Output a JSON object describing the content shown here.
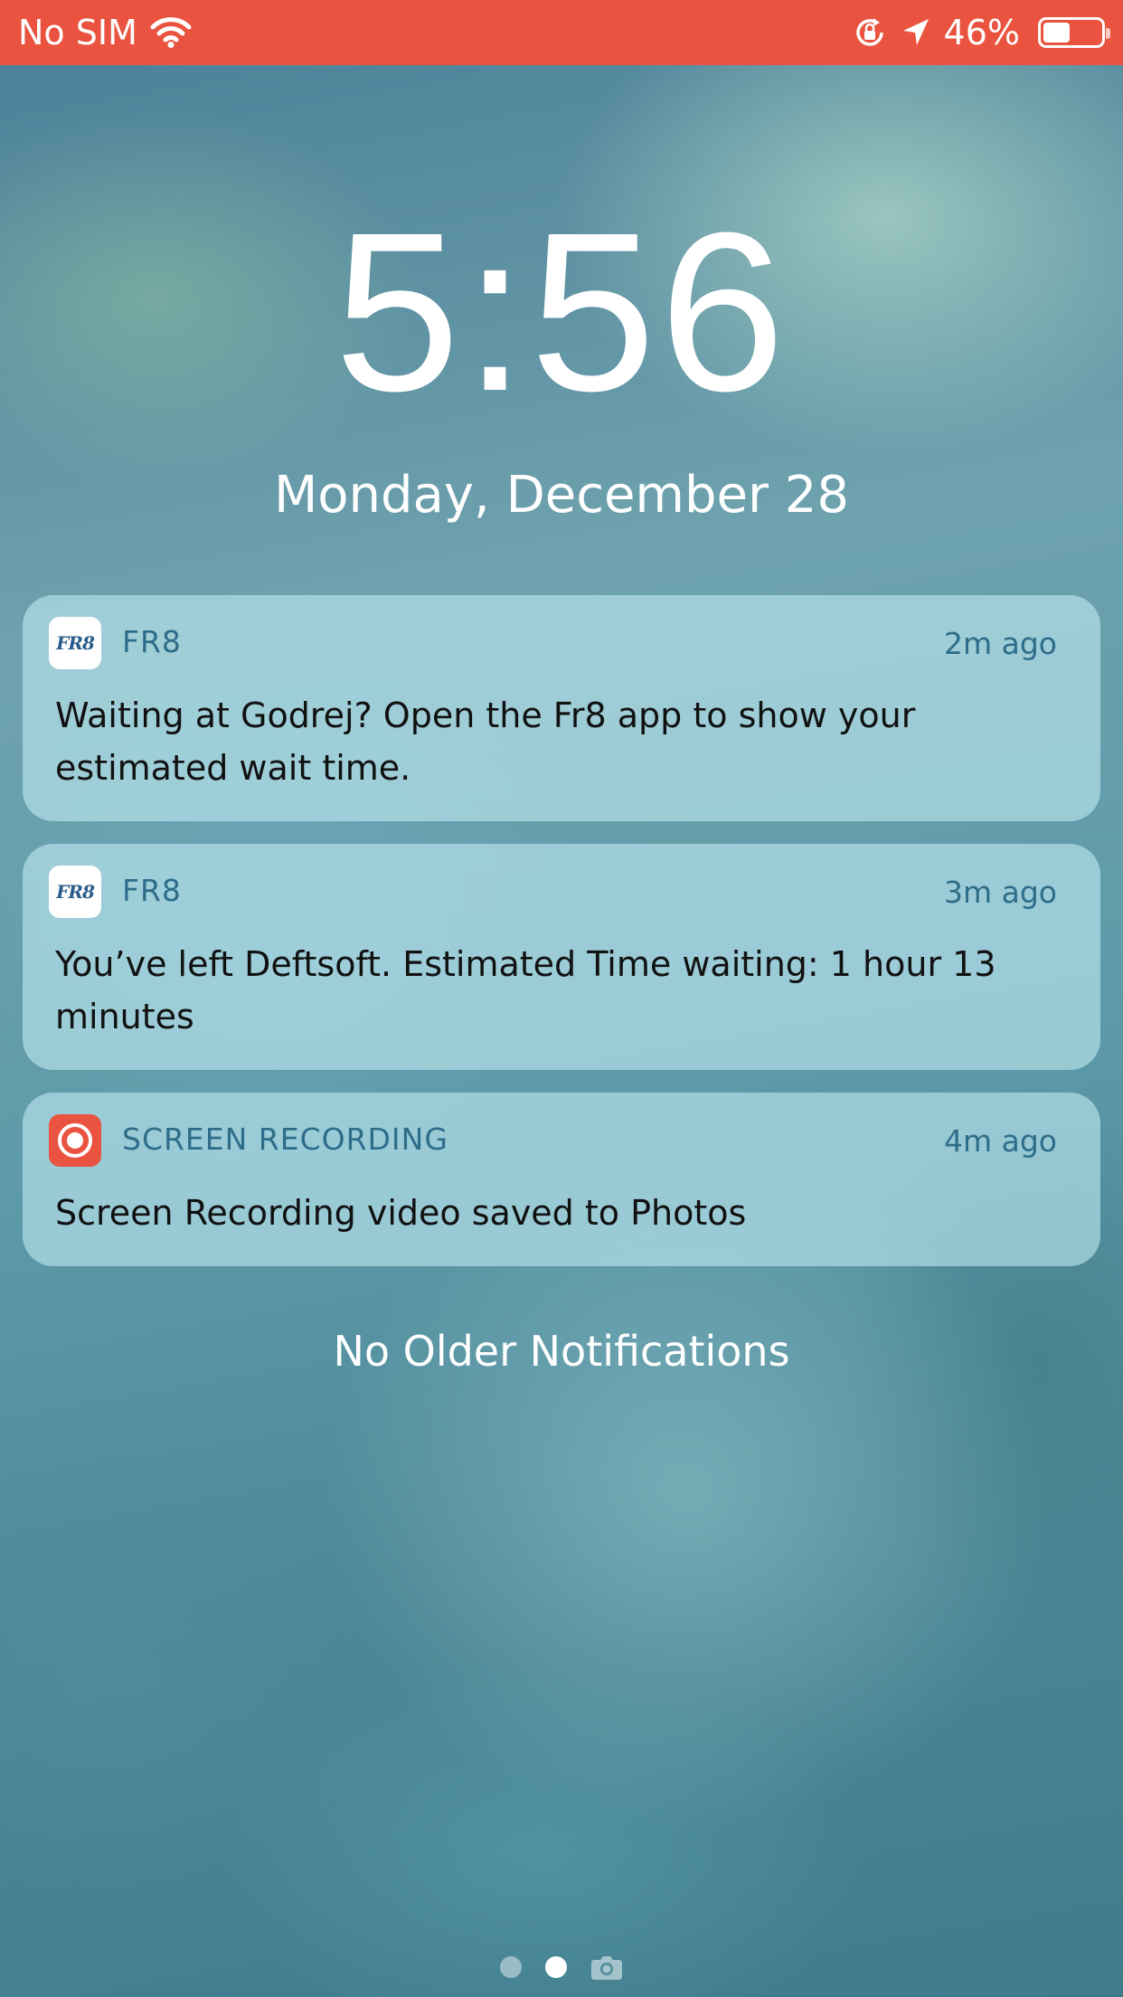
{
  "status_bar": {
    "carrier": "No SIM",
    "battery_percent_text": "46%",
    "battery_level": 0.46,
    "wifi_icon": "wifi-icon",
    "orientation_lock_icon": "orientation-lock-icon",
    "location_icon": "location-arrow-icon",
    "battery_icon": "battery-icon",
    "background_color": "#e9533f"
  },
  "lock_screen": {
    "time": "5:56",
    "date": "Monday, December 28"
  },
  "notifications": [
    {
      "app": "FR8",
      "icon": "fr8-app-icon",
      "icon_text": "FR8",
      "time_ago": "2m ago",
      "body": "Waiting at Godrej? Open the Fr8 app to show your estimated wait time."
    },
    {
      "app": "FR8",
      "icon": "fr8-app-icon",
      "icon_text": "FR8",
      "time_ago": "3m ago",
      "body": "You’ve left Deftsoft. Estimated Time waiting: 1 hour 13 minutes"
    },
    {
      "app": "SCREEN RECORDING",
      "icon": "screen-recording-icon",
      "time_ago": "4m ago",
      "body": "Screen Recording video saved to Photos"
    }
  ],
  "footer": {
    "no_older": "No Older Notifications"
  },
  "page_indicator": {
    "pages": 3,
    "active_index": 1,
    "camera_icon": "camera-icon"
  }
}
